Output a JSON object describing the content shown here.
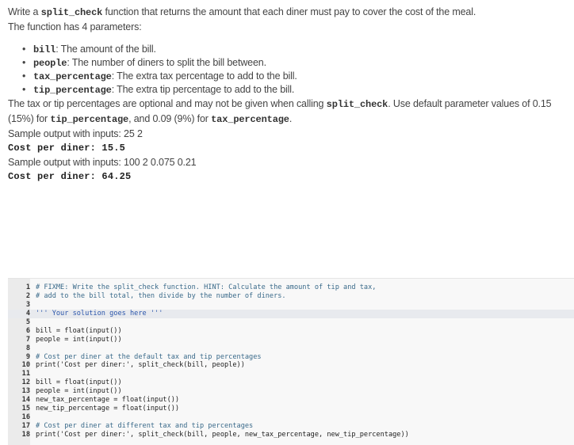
{
  "instructions": {
    "intro_prefix": "Write a ",
    "intro_code": "split_check",
    "intro_suffix": " function that returns the amount that each diner must pay to cover the cost of the meal.",
    "params_heading": "The function has 4 parameters:",
    "params": [
      {
        "name": "bill",
        "desc": ": The amount of the bill."
      },
      {
        "name": "people",
        "desc": ": The number of diners to split the bill between."
      },
      {
        "name": "tax_percentage",
        "desc": ": The extra tax percentage to add to the bill."
      },
      {
        "name": "tip_percentage",
        "desc": ": The extra tip percentage to add to the bill."
      }
    ],
    "optional_part1": "The tax or tip percentages are optional and may not be given when calling ",
    "optional_code1": "split_check",
    "optional_part2": ". Use default parameter values of 0.15 (15%) for ",
    "optional_code2": "tip_percentage",
    "optional_part3": ", and 0.09 (9%) for ",
    "optional_code3": "tax_percentage",
    "optional_part4": ".",
    "sample1_label": "Sample output with inputs: 25 2",
    "sample1_output": "Cost per diner: 15.5",
    "sample2_label": "Sample output with inputs: 100 2 0.075 0.21",
    "sample2_output": "Cost per diner: 64.25"
  },
  "editor": {
    "active_line": 4,
    "lines": [
      {
        "num": "1",
        "text": "# FIXME: Write the split_check function. HINT: Calculate the amount of tip and tax,"
      },
      {
        "num": "2",
        "text": "# add to the bill total, then divide by the number of diners."
      },
      {
        "num": "3",
        "text": ""
      },
      {
        "num": "4",
        "text": "''' Your solution goes here '''"
      },
      {
        "num": "5",
        "text": ""
      },
      {
        "num": "6",
        "text": "bill = float(input())"
      },
      {
        "num": "7",
        "text": "people = int(input())"
      },
      {
        "num": "8",
        "text": ""
      },
      {
        "num": "9",
        "text": "# Cost per diner at the default tax and tip percentages"
      },
      {
        "num": "10",
        "text": "print('Cost per diner:', split_check(bill, people))"
      },
      {
        "num": "11",
        "text": ""
      },
      {
        "num": "12",
        "text": "bill = float(input())"
      },
      {
        "num": "13",
        "text": "people = int(input())"
      },
      {
        "num": "14",
        "text": "new_tax_percentage = float(input())"
      },
      {
        "num": "15",
        "text": "new_tip_percentage = float(input())"
      },
      {
        "num": "16",
        "text": ""
      },
      {
        "num": "17",
        "text": "# Cost per diner at different tax and tip percentages"
      },
      {
        "num": "18",
        "text": "print('Cost per diner:', split_check(bill, people, new_tax_percentage, new_tip_percentage))"
      }
    ]
  }
}
